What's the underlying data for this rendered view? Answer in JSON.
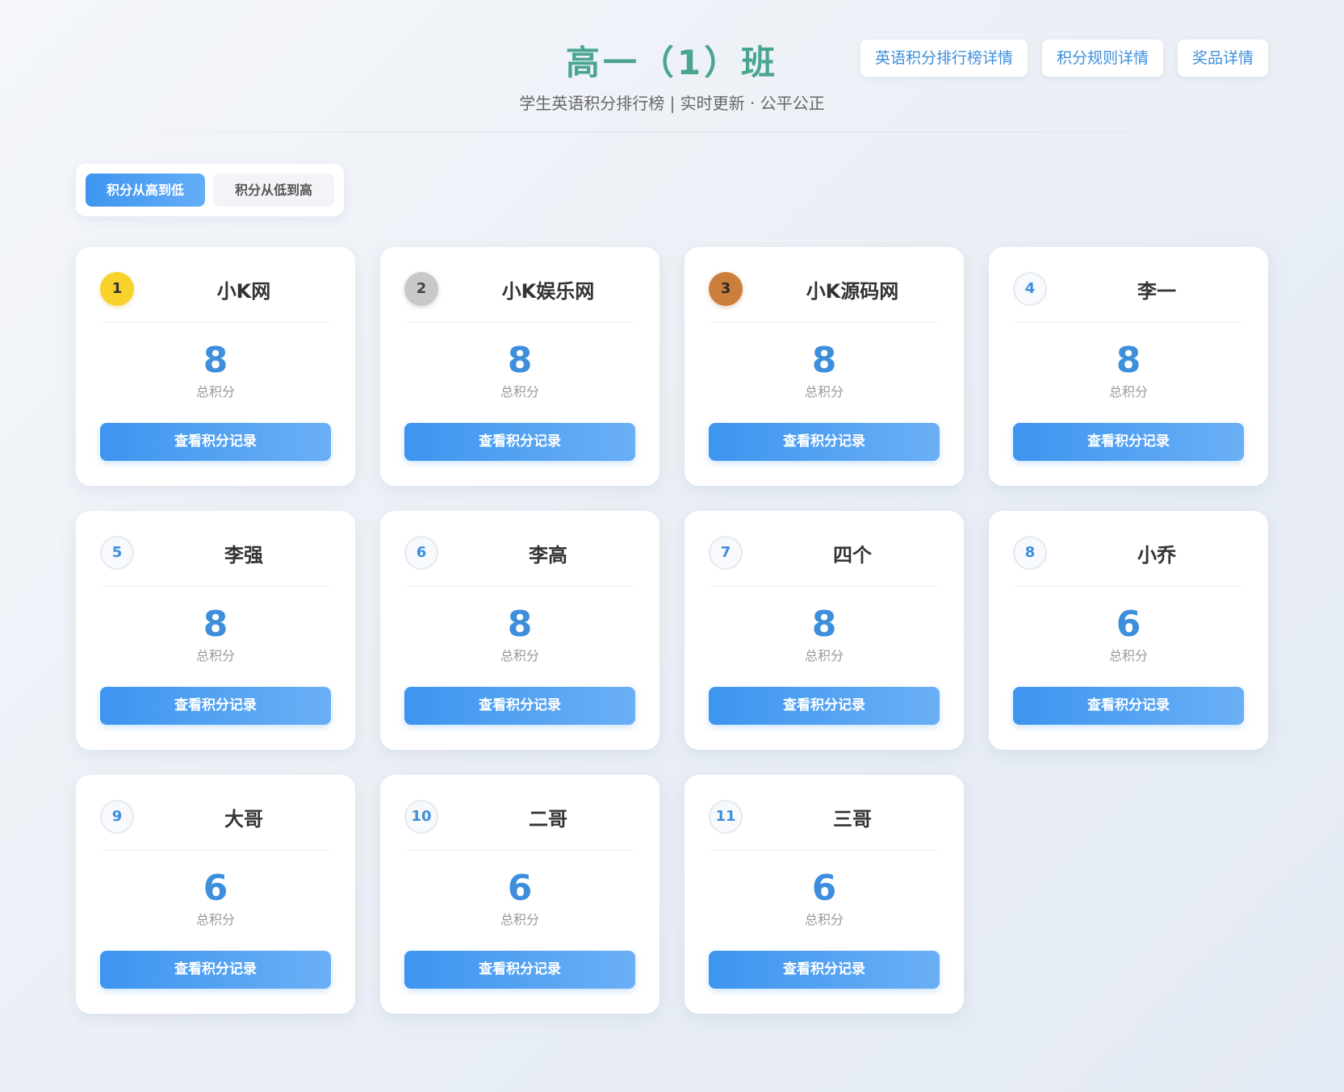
{
  "header": {
    "title": "高一（1）班",
    "subtitle": "学生英语积分排行榜 | 实时更新 · 公平公正",
    "links": [
      {
        "label": "英语积分排行榜详情"
      },
      {
        "label": "积分规则详情"
      },
      {
        "label": "奖品详情"
      }
    ]
  },
  "sort": {
    "high_to_low": "积分从高到低",
    "low_to_high": "积分从低到高",
    "active": "high_to_low"
  },
  "card_labels": {
    "score_label": "总积分",
    "button_label": "查看积分记录"
  },
  "colors": {
    "title": "#4aa58f",
    "accent": "#3d8fdc",
    "gold": "#f8d12a",
    "silver": "#c8c8c8",
    "bronze": "#cc7f3b"
  },
  "students": [
    {
      "rank": "1",
      "name": "小K网",
      "score": "8",
      "medal": "gold"
    },
    {
      "rank": "2",
      "name": "小K娱乐网",
      "score": "8",
      "medal": "silver"
    },
    {
      "rank": "3",
      "name": "小K源码网",
      "score": "8",
      "medal": "bronze"
    },
    {
      "rank": "4",
      "name": "李一",
      "score": "8",
      "medal": "plain"
    },
    {
      "rank": "5",
      "name": "李强",
      "score": "8",
      "medal": "plain"
    },
    {
      "rank": "6",
      "name": "李高",
      "score": "8",
      "medal": "plain"
    },
    {
      "rank": "7",
      "name": "四个",
      "score": "8",
      "medal": "plain"
    },
    {
      "rank": "8",
      "name": "小乔",
      "score": "6",
      "medal": "plain"
    },
    {
      "rank": "9",
      "name": "大哥",
      "score": "6",
      "medal": "plain"
    },
    {
      "rank": "10",
      "name": "二哥",
      "score": "6",
      "medal": "plain"
    },
    {
      "rank": "11",
      "name": "三哥",
      "score": "6",
      "medal": "plain"
    }
  ]
}
